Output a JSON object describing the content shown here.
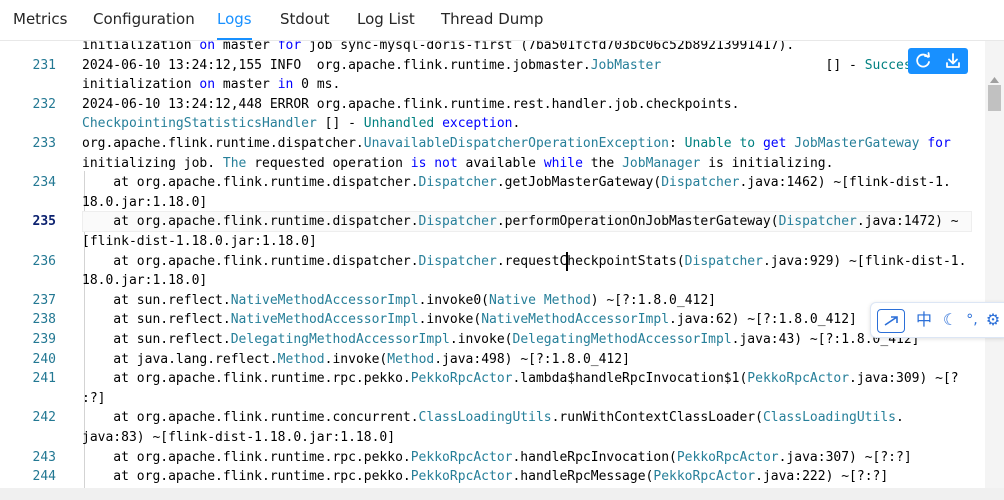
{
  "tabs": [
    {
      "label": "Metrics"
    },
    {
      "label": "Configuration"
    },
    {
      "label": "Logs"
    },
    {
      "label": "Stdout"
    },
    {
      "label": "Log List"
    },
    {
      "label": "Thread Dump"
    }
  ],
  "active_tab": "Logs",
  "colors": {
    "accent": "#1890ff",
    "keyword": "#0000ff",
    "type": "#267f99",
    "line_number": "#237893"
  },
  "toolbar": {
    "refresh_icon": "refresh-icon",
    "download_icon": "download-icon"
  },
  "ime_bar": {
    "lang": "中",
    "icons": [
      "ime-toggle-icon",
      "moon-icon",
      "punctuation-icon",
      "settings-icon"
    ]
  },
  "log": {
    "current_line": "235",
    "lines": [
      {
        "num": "",
        "segs": [
          [
            "w",
            "initialization "
          ],
          [
            "b",
            "on"
          ],
          [
            "w",
            " master "
          ],
          [
            "b",
            "for"
          ],
          [
            "w",
            " job sync-mysql-doris-first (7ba501fcfd703bc06c52b89213991417)."
          ]
        ]
      },
      {
        "num": "231",
        "segs": [
          [
            "w",
            "2024-06-10 13:24:12,155 INFO  org.apache.flink.runtime.jobmaster."
          ],
          [
            "t",
            "JobMaster"
          ],
          [
            "w",
            "                     [] - "
          ],
          [
            "c",
            "Successf"
          ]
        ]
      },
      {
        "num": "",
        "segs": [
          [
            "w",
            "initialization "
          ],
          [
            "b",
            "on"
          ],
          [
            "w",
            " master "
          ],
          [
            "b",
            "in"
          ],
          [
            "w",
            " 0 ms."
          ]
        ]
      },
      {
        "num": "232",
        "segs": [
          [
            "w",
            "2024-06-10 13:24:12,448 ERROR org.apache.flink.runtime.rest.handler.job.checkpoints."
          ]
        ]
      },
      {
        "num": "",
        "segs": [
          [
            "t",
            "CheckpointingStatisticsHandler"
          ],
          [
            "w",
            " [] - "
          ],
          [
            "c",
            "Unhandled"
          ],
          [
            "w",
            " "
          ],
          [
            "b",
            "exception"
          ],
          [
            "w",
            "."
          ]
        ]
      },
      {
        "num": "233",
        "segs": [
          [
            "w",
            "org.apache.flink.runtime.dispatcher."
          ],
          [
            "t",
            "UnavailableDispatcherOperationException"
          ],
          [
            "w",
            ": "
          ],
          [
            "c",
            "Unable"
          ],
          [
            "w",
            " "
          ],
          [
            "c",
            "to"
          ],
          [
            "w",
            " "
          ],
          [
            "b",
            "get"
          ],
          [
            "w",
            " "
          ],
          [
            "t",
            "JobMasterGateway"
          ],
          [
            "w",
            " "
          ],
          [
            "b",
            "for"
          ]
        ]
      },
      {
        "num": "",
        "segs": [
          [
            "w",
            "initializing job. "
          ],
          [
            "t",
            "The"
          ],
          [
            "w",
            " requested operation "
          ],
          [
            "b",
            "is"
          ],
          [
            "w",
            " "
          ],
          [
            "b",
            "not"
          ],
          [
            "w",
            " available "
          ],
          [
            "b",
            "while"
          ],
          [
            "w",
            " the "
          ],
          [
            "t",
            "JobManager"
          ],
          [
            "w",
            " is initializing."
          ]
        ]
      },
      {
        "num": "234",
        "segs": [
          [
            "w",
            "    at org.apache.flink.runtime.dispatcher."
          ],
          [
            "t",
            "Dispatcher"
          ],
          [
            "w",
            ".getJobMasterGateway("
          ],
          [
            "t",
            "Dispatcher"
          ],
          [
            "w",
            ".java:1462) ~[flink-dist-1."
          ]
        ]
      },
      {
        "num": "",
        "segs": [
          [
            "w",
            "18.0.jar:1.18.0]"
          ]
        ]
      },
      {
        "num": "235",
        "segs": [
          [
            "w",
            "    at org.apache.flink.runtime.dispatcher."
          ],
          [
            "t",
            "Dispatcher"
          ],
          [
            "w",
            ".performOperationOnJobMasterGateway("
          ],
          [
            "t",
            "Dispatcher"
          ],
          [
            "w",
            ".java:1472) ~"
          ]
        ]
      },
      {
        "num": "",
        "segs": [
          [
            "w",
            "[flink-dist-1.18.0.jar:1.18.0]"
          ]
        ]
      },
      {
        "num": "236",
        "segs": [
          [
            "w",
            "    at org.apache.flink.runtime.dispatcher."
          ],
          [
            "t",
            "Dispatcher"
          ],
          [
            "w",
            ".requestCheckpointStats("
          ],
          [
            "t",
            "Dispatcher"
          ],
          [
            "w",
            ".java:929) ~[flink-dist-1."
          ]
        ]
      },
      {
        "num": "",
        "segs": [
          [
            "w",
            "18.0.jar:1.18.0]"
          ]
        ]
      },
      {
        "num": "237",
        "segs": [
          [
            "w",
            "    at sun.reflect."
          ],
          [
            "t",
            "NativeMethodAccessorImpl"
          ],
          [
            "w",
            ".invoke0("
          ],
          [
            "t",
            "Native"
          ],
          [
            "w",
            " "
          ],
          [
            "t",
            "Method"
          ],
          [
            "w",
            ") ~[?:1.8.0_412]"
          ]
        ]
      },
      {
        "num": "238",
        "segs": [
          [
            "w",
            "    at sun.reflect."
          ],
          [
            "t",
            "NativeMethodAccessorImpl"
          ],
          [
            "w",
            ".invoke("
          ],
          [
            "t",
            "NativeMethodAccessorImpl"
          ],
          [
            "w",
            ".java:62) ~[?:1.8.0_412]"
          ]
        ]
      },
      {
        "num": "239",
        "segs": [
          [
            "w",
            "    at sun.reflect."
          ],
          [
            "t",
            "DelegatingMethodAccessorImpl"
          ],
          [
            "w",
            ".invoke("
          ],
          [
            "t",
            "DelegatingMethodAccessorImpl"
          ],
          [
            "w",
            ".java:43) ~[?:1.8.0_412]"
          ]
        ]
      },
      {
        "num": "240",
        "segs": [
          [
            "w",
            "    at java.lang.reflect."
          ],
          [
            "t",
            "Method"
          ],
          [
            "w",
            ".invoke("
          ],
          [
            "t",
            "Method"
          ],
          [
            "w",
            ".java:498) ~[?:1.8.0_412]"
          ]
        ]
      },
      {
        "num": "241",
        "segs": [
          [
            "w",
            "    at org.apache.flink.runtime.rpc.pekko."
          ],
          [
            "t",
            "PekkoRpcActor"
          ],
          [
            "w",
            ".lambda$handleRpcInvocation$1("
          ],
          [
            "t",
            "PekkoRpcActor"
          ],
          [
            "w",
            ".java:309) ~[?"
          ]
        ]
      },
      {
        "num": "",
        "segs": [
          [
            "w",
            ":?]"
          ]
        ]
      },
      {
        "num": "242",
        "segs": [
          [
            "w",
            "    at org.apache.flink.runtime.concurrent."
          ],
          [
            "t",
            "ClassLoadingUtils"
          ],
          [
            "w",
            ".runWithContextClassLoader("
          ],
          [
            "t",
            "ClassLoadingUtils"
          ],
          [
            "w",
            "."
          ]
        ]
      },
      {
        "num": "",
        "segs": [
          [
            "w",
            "java:83) ~[flink-dist-1.18.0.jar:1.18.0]"
          ]
        ]
      },
      {
        "num": "243",
        "segs": [
          [
            "w",
            "    at org.apache.flink.runtime.rpc.pekko."
          ],
          [
            "t",
            "PekkoRpcActor"
          ],
          [
            "w",
            ".handleRpcInvocation("
          ],
          [
            "t",
            "PekkoRpcActor"
          ],
          [
            "w",
            ".java:307) ~[?:?]"
          ]
        ]
      },
      {
        "num": "244",
        "segs": [
          [
            "w",
            "    at org.apache.flink.runtime.rpc.pekko."
          ],
          [
            "t",
            "PekkoRpcActor"
          ],
          [
            "w",
            ".handleRpcMessage("
          ],
          [
            "t",
            "PekkoRpcActor"
          ],
          [
            "w",
            ".java:222) ~[?:?]"
          ]
        ]
      }
    ]
  }
}
